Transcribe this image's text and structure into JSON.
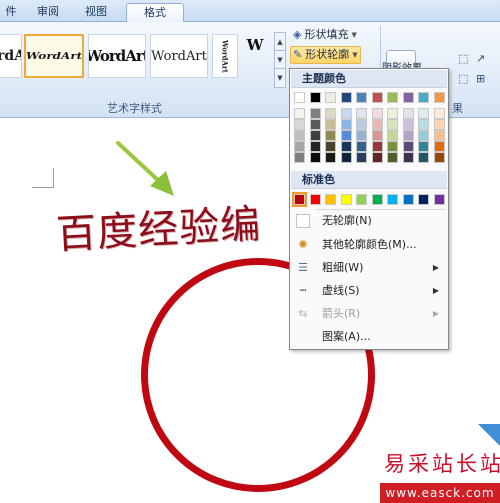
{
  "tabs": [
    "件",
    "审阅",
    "视图",
    "格式"
  ],
  "wordart_gallery": [
    "WordArt",
    "WordArt",
    "WordArt",
    "WordArt",
    "WordArt",
    "W"
  ],
  "ribbon": {
    "group_label": "艺术字样式",
    "shape_fill": "形状填充",
    "shape_outline": "形状轮廓",
    "right_group_label": "果",
    "projection_label": "阴影效果"
  },
  "document": {
    "wordart_text": "百度经验编"
  },
  "outline_menu": {
    "theme_colors_header": "主题颜色",
    "standard_colors_header": "标准色",
    "theme_row": [
      "#ffffff",
      "#000000",
      "#eeece1",
      "#1f497d",
      "#4f81bd",
      "#c0504d",
      "#9bbb59",
      "#8064a2",
      "#4bacc6",
      "#f79646"
    ],
    "shade_columns": [
      [
        "#f2f2f2",
        "#d8d8d8",
        "#bfbfbf",
        "#a5a5a5",
        "#7f7f7f"
      ],
      [
        "#7f7f7f",
        "#595959",
        "#3f3f3f",
        "#262626",
        "#0c0c0c"
      ],
      [
        "#ddd9c3",
        "#c4bd97",
        "#938953",
        "#494429",
        "#1d1b10"
      ],
      [
        "#c6d9f0",
        "#8db3e2",
        "#548dd4",
        "#17365d",
        "#0f243e"
      ],
      [
        "#dbe5f1",
        "#b8cce4",
        "#95b3d7",
        "#366092",
        "#244061"
      ],
      [
        "#f2dcdb",
        "#e5b9b7",
        "#d99694",
        "#953734",
        "#632423"
      ],
      [
        "#ebf1dd",
        "#d7e3bc",
        "#c3d69b",
        "#76923c",
        "#4f6128"
      ],
      [
        "#e5e0ec",
        "#ccc1d9",
        "#b2a2c7",
        "#5f497a",
        "#3f3151"
      ],
      [
        "#dbeef3",
        "#b7dde8",
        "#92cddc",
        "#31859b",
        "#205867"
      ],
      [
        "#fdeada",
        "#fbd5b5",
        "#fac08f",
        "#e36c09",
        "#974806"
      ]
    ],
    "standard_row": [
      "#c00000",
      "#ff0000",
      "#ffc000",
      "#ffff00",
      "#92d050",
      "#00b050",
      "#00b0f0",
      "#0070c0",
      "#002060",
      "#7030a0"
    ],
    "items": {
      "no_outline": "无轮廓(N)",
      "more_colors": "其他轮廓颜色(M)...",
      "weight": "粗细(W)",
      "dashes": "虚线(S)",
      "arrows": "箭头(R)",
      "pattern": "图案(A)..."
    }
  },
  "watermark": {
    "title": "易采站长站",
    "url": "www.easck.com"
  }
}
